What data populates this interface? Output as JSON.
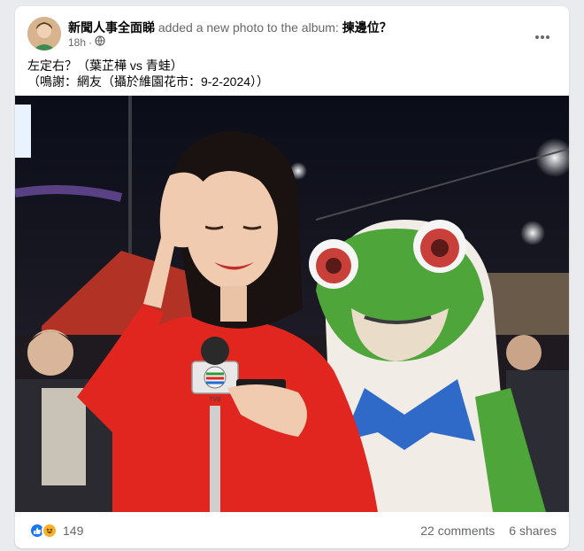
{
  "post": {
    "page_name": "新聞人事全面睇",
    "action_text": "added a new photo to the album:",
    "album_name": "揀邊位？",
    "time": "18h",
    "caption_line1": "左定右？（葉芷樺 vs 青蛙）",
    "caption_line2": "（鳴謝：網友（攝於維園花市：9-2-2024））"
  },
  "footer": {
    "reaction_count": "149",
    "comments": "22 comments",
    "shares": "6 shares"
  },
  "photo": {
    "mic_logo": "TVB"
  },
  "colors": {
    "like": "#1877f2",
    "haha": "#f7b125",
    "dress": "#e0261f",
    "frog": "#4ea53a"
  }
}
